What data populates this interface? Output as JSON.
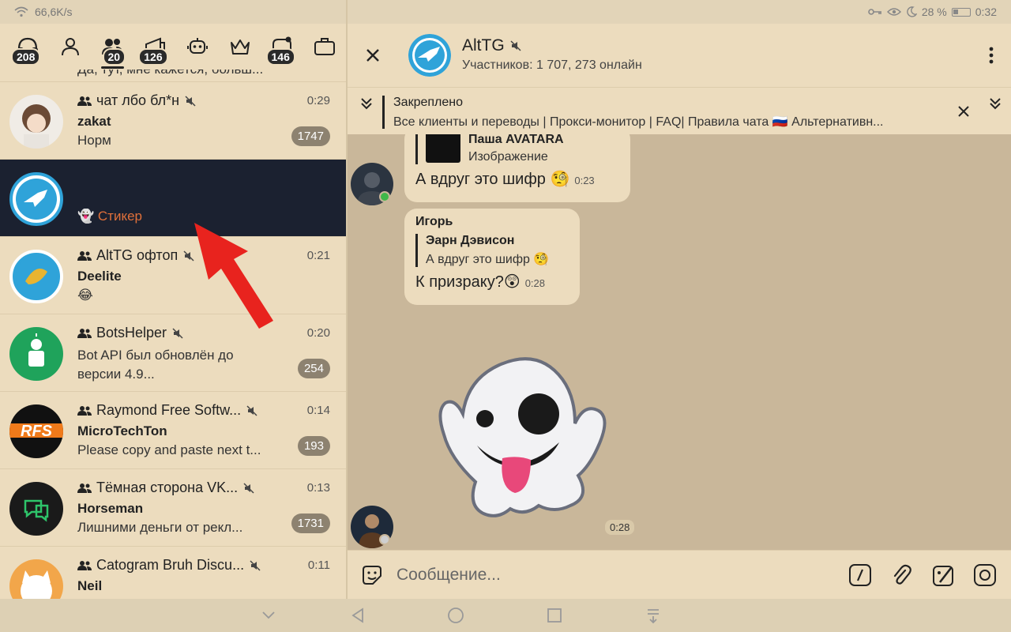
{
  "status_bar": {
    "speed": "66,6K/s",
    "battery": "28 %",
    "time": "0:32"
  },
  "folders": [
    {
      "icon": "all-chats-icon",
      "badge": "208"
    },
    {
      "icon": "user-icon",
      "badge": ""
    },
    {
      "icon": "group-icon",
      "badge": "20"
    },
    {
      "icon": "channel-icon",
      "badge": "126"
    },
    {
      "icon": "bot-icon",
      "badge": ""
    },
    {
      "icon": "crown-icon",
      "badge": ""
    },
    {
      "icon": "unread-icon",
      "badge": "146"
    },
    {
      "icon": "briefcase-icon",
      "badge": ""
    }
  ],
  "chats": [
    {
      "name": "",
      "time": "",
      "sender": "",
      "message": "Да, тут, мне кажется, больш...",
      "unread": ""
    },
    {
      "name": "чат лбо бл*н",
      "time": "0:29",
      "sender": "zakat",
      "message": "Норм",
      "unread": "1747"
    },
    {
      "name": "",
      "time": "",
      "sender": "",
      "message": "Стикер",
      "unread": ""
    },
    {
      "name": "AltTG офтоп",
      "time": "0:21",
      "sender": "Deelite",
      "message": "😂",
      "unread": ""
    },
    {
      "name": "BotsHelper",
      "time": "0:20",
      "sender": "",
      "message": "Bot API был обновлён до версии 4.9...",
      "unread": "254"
    },
    {
      "name": "Raymond Free Softw...",
      "time": "0:14",
      "sender": "MicroTechTon",
      "message": "Please copy and paste next t...",
      "unread": "193"
    },
    {
      "name": "Тёмная сторона VK...",
      "time": "0:13",
      "sender": "Horseman",
      "message": "Лишними деньги от рекл...",
      "unread": "1731"
    },
    {
      "name": "Catogram Bruh Discu...",
      "time": "0:11",
      "sender": "Neil",
      "message": "",
      "unread": ""
    }
  ],
  "header": {
    "title": "AltTG",
    "subtitle": "Участников: 1 707, 273 онлайн"
  },
  "pinned": {
    "title": "Закреплено",
    "text": "Все клиенты и переводы | Прокси-монитор | FAQ| Правила чата 🇷🇺 Альтернативн..."
  },
  "messages": [
    {
      "reply_name": "Паша AVATARA",
      "reply_text": "Изображение",
      "text": "А вдруг это шифр 🧐",
      "time": "0:23"
    },
    {
      "sender": "Игорь",
      "reply_name": "Эарн Дэвисон",
      "reply_text": "А вдруг это шифр 🧐",
      "text": "К призраку?😲",
      "time": "0:28"
    },
    {
      "sticker": "ghost-sticker",
      "time": "0:28"
    }
  ],
  "composer": {
    "placeholder": "Сообщение..."
  },
  "colors": {
    "background": "#c9b79a",
    "panel": "#ecdcbe",
    "selected": "#1b2130",
    "accent": "#2fa3d9",
    "sticker_label": "#e0703a"
  }
}
